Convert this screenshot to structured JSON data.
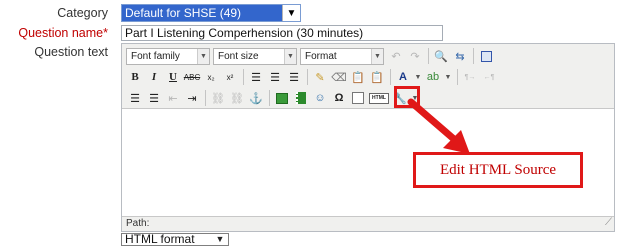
{
  "form": {
    "category_label": "Category",
    "category_value": "Default for SHSE (49)",
    "question_name_label": "Question name",
    "required_star": "*",
    "question_name_value": "Part I Listening Comperhension (30 minutes)",
    "question_text_label": "Question text",
    "text_format_value": "HTML format"
  },
  "editor": {
    "font_family_label": "Font family",
    "font_size_label": "Font size",
    "format_label": "Format",
    "html_icon_text": "HTML",
    "path_label": "Path:"
  },
  "annotation": {
    "callout_text": "Edit HTML Source",
    "color": "#e01818"
  }
}
